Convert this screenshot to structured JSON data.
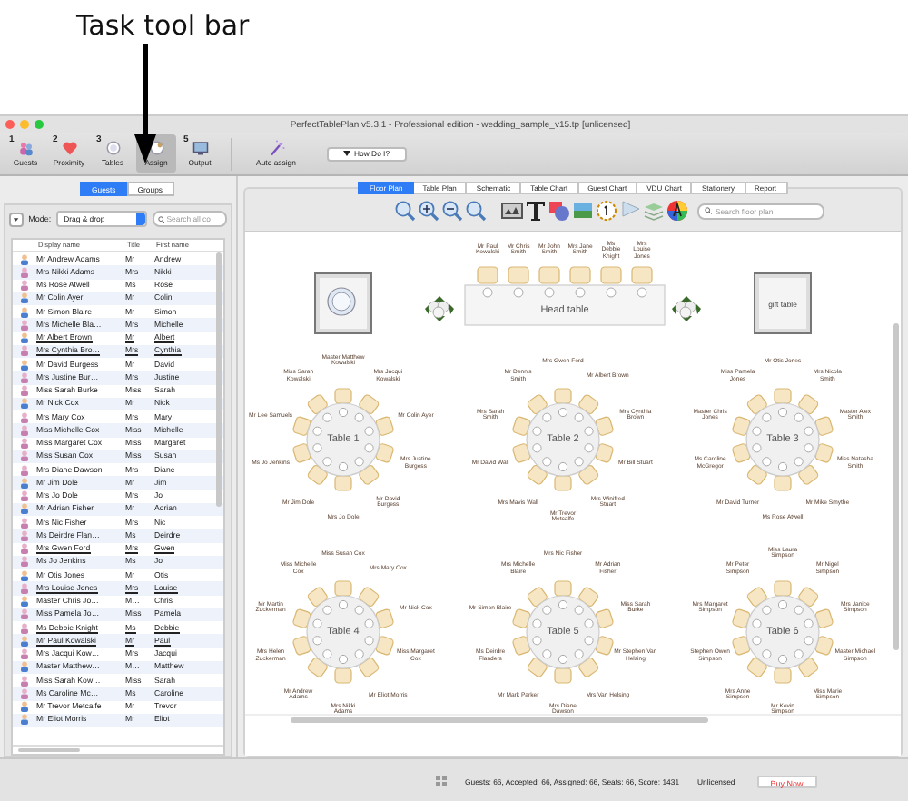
{
  "annotation": {
    "text": "Task tool bar"
  },
  "window": {
    "title": "PerfectTablePlan v5.3.1 - Professional edition - wedding_sample_v15.tp [unlicensed]"
  },
  "toolbar": {
    "tasks": [
      {
        "number": "1",
        "label": "Guests",
        "selected": false
      },
      {
        "number": "2",
        "label": "Proximity",
        "selected": false
      },
      {
        "number": "3",
        "label": "Tables",
        "selected": false
      },
      {
        "label": "Assign",
        "selected": true
      },
      {
        "number": "5",
        "label": "Output",
        "selected": false
      }
    ],
    "auto_assign": "Auto assign",
    "help_button": "How Do I?"
  },
  "left_panel": {
    "tabs": [
      {
        "label": "Guests",
        "selected": true
      },
      {
        "label": "Groups",
        "selected": false
      }
    ],
    "mode_label": "Mode:",
    "mode_value": "Drag & drop",
    "search_placeholder": "Search all co",
    "columns": [
      "Display name",
      "Title",
      "First name"
    ],
    "rows": [
      {
        "kind": "male",
        "name": "Mr Andrew Adams",
        "title": "Mr",
        "first": "Andrew",
        "underlined": false
      },
      {
        "kind": "female",
        "name": "Mrs Nikki Adams",
        "title": "Mrs",
        "first": "Nikki",
        "underlined": false
      },
      {
        "kind": "female",
        "name": "Ms Rose Atwell",
        "title": "Ms",
        "first": "Rose",
        "underlined": false
      },
      {
        "kind": "male",
        "name": "Mr Colin Ayer",
        "title": "Mr",
        "first": "Colin",
        "underlined": false
      },
      {
        "kind": "male",
        "name": "Mr Simon Blaire",
        "title": "Mr",
        "first": "Simon",
        "underlined": false
      },
      {
        "kind": "female",
        "name": "Mrs Michelle Bla…",
        "title": "Mrs",
        "first": "Michelle",
        "underlined": false
      },
      {
        "kind": "male",
        "name": "Mr Albert Brown",
        "title": "Mr",
        "first": "Albert",
        "underlined": true
      },
      {
        "kind": "female",
        "name": "Mrs Cynthia Bro…",
        "title": "Mrs",
        "first": "Cynthia",
        "underlined": true
      },
      {
        "kind": "male",
        "name": "Mr David Burgess",
        "title": "Mr",
        "first": "David",
        "underlined": false
      },
      {
        "kind": "female",
        "name": "Mrs Justine Bur…",
        "title": "Mrs",
        "first": "Justine",
        "underlined": false
      },
      {
        "kind": "female",
        "name": "Miss Sarah Burke",
        "title": "Miss",
        "first": "Sarah",
        "underlined": false
      },
      {
        "kind": "male",
        "name": "Mr Nick Cox",
        "title": "Mr",
        "first": "Nick",
        "underlined": false
      },
      {
        "kind": "female",
        "name": "Mrs Mary Cox",
        "title": "Mrs",
        "first": "Mary",
        "underlined": false
      },
      {
        "kind": "female",
        "name": "Miss Michelle Cox",
        "title": "Miss",
        "first": "Michelle",
        "underlined": false
      },
      {
        "kind": "female",
        "name": "Miss Margaret Cox",
        "title": "Miss",
        "first": "Margaret",
        "underlined": false
      },
      {
        "kind": "female",
        "name": "Miss Susan Cox",
        "title": "Miss",
        "first": "Susan",
        "underlined": false
      },
      {
        "kind": "female",
        "name": "Mrs Diane Dawson",
        "title": "Mrs",
        "first": "Diane",
        "underlined": false
      },
      {
        "kind": "male",
        "name": "Mr Jim Dole",
        "title": "Mr",
        "first": "Jim",
        "underlined": false
      },
      {
        "kind": "female",
        "name": "Mrs Jo Dole",
        "title": "Mrs",
        "first": "Jo",
        "underlined": false
      },
      {
        "kind": "male",
        "name": "Mr Adrian Fisher",
        "title": "Mr",
        "first": "Adrian",
        "underlined": false
      },
      {
        "kind": "female",
        "name": "Mrs Nic Fisher",
        "title": "Mrs",
        "first": "Nic",
        "underlined": false
      },
      {
        "kind": "female",
        "name": "Ms Deirdre Flan…",
        "title": "Ms",
        "first": "Deirdre",
        "underlined": false
      },
      {
        "kind": "female",
        "name": "Mrs Gwen Ford",
        "title": "Mrs",
        "first": "Gwen",
        "underlined": true
      },
      {
        "kind": "female",
        "name": "Ms Jo Jenkins",
        "title": "Ms",
        "first": "Jo",
        "underlined": false
      },
      {
        "kind": "male",
        "name": "Mr Otis Jones",
        "title": "Mr",
        "first": "Otis",
        "underlined": false
      },
      {
        "kind": "female",
        "name": "Mrs Louise Jones",
        "title": "Mrs",
        "first": "Louise",
        "underlined": true
      },
      {
        "kind": "male",
        "name": "Master Chris Jo…",
        "title": "M…",
        "first": "Chris",
        "underlined": false
      },
      {
        "kind": "female",
        "name": "Miss Pamela Jo…",
        "title": "Miss",
        "first": "Pamela",
        "underlined": false
      },
      {
        "kind": "female",
        "name": "Ms Debbie Knight",
        "title": "Ms",
        "first": "Debbie",
        "underlined": true
      },
      {
        "kind": "male",
        "name": "Mr Paul Kowalski",
        "title": "Mr",
        "first": "Paul",
        "underlined": true
      },
      {
        "kind": "female",
        "name": "Mrs Jacqui Kow…",
        "title": "Mrs",
        "first": "Jacqui",
        "underlined": false
      },
      {
        "kind": "male",
        "name": "Master Matthew…",
        "title": "M…",
        "first": "Matthew",
        "underlined": false
      },
      {
        "kind": "female",
        "name": "Miss Sarah Kow…",
        "title": "Miss",
        "first": "Sarah",
        "underlined": false
      },
      {
        "kind": "female",
        "name": "Ms Caroline Mc…",
        "title": "Ms",
        "first": "Caroline",
        "underlined": false
      },
      {
        "kind": "male",
        "name": "Mr Trevor Metcalfe",
        "title": "Mr",
        "first": "Trevor",
        "underlined": false
      },
      {
        "kind": "male",
        "name": "Mr Eliot Morris",
        "title": "Mr",
        "first": "Eliot",
        "underlined": false
      }
    ]
  },
  "right_panel": {
    "tabs": [
      {
        "label": "Floor Plan",
        "selected": true
      },
      {
        "label": "Table Plan",
        "selected": false
      },
      {
        "label": "Schematic",
        "selected": false
      },
      {
        "label": "Table Chart",
        "selected": false
      },
      {
        "label": "Guest Chart",
        "selected": false
      },
      {
        "label": "VDU Chart",
        "selected": false
      },
      {
        "label": "Stationery",
        "selected": false
      },
      {
        "label": "Report",
        "selected": false
      }
    ],
    "search_placeholder": "Search floor plan",
    "floor_plan": {
      "head_table": {
        "label": "Head table",
        "seats": [
          "Mr Paul Kowalski",
          "Mr Chris Smith",
          "Mr John Smith",
          "Mrs Jane Smith",
          "Ms Debbie Knight",
          "Mrs Louise Jones"
        ]
      },
      "gift_table": {
        "label": "gift table"
      },
      "tables": [
        {
          "label": "Table 1",
          "seats": [
            "Master Matthew Kowalski",
            "Miss Sarah Kowalski",
            "Mrs Jacqui Kowalski",
            "Mr Lee Samuels",
            "Mr Colin Ayer",
            "Ms Jo Jenkins",
            "Mrs Justine Burgess",
            "Mr Jim Dole",
            "Mr David Burgess",
            "Mrs Jo Dole"
          ]
        },
        {
          "label": "Table 2",
          "seats": [
            "Mrs Gwen Ford",
            "Mr Dennis Smith",
            "Mr Albert Brown",
            "Mrs Sarah Smith",
            "Mrs Cynthia Brown",
            "Mr David Wall",
            "Mr Bill Stuart",
            "Mrs Mavis Wall",
            "Mrs Winifred Stuart",
            "Mr Trevor Metcalfe"
          ]
        },
        {
          "label": "Table 3",
          "seats": [
            "Mr Otis Jones",
            "Miss Pamela Jones",
            "Mrs Nicola Smith",
            "Master Chris Jones",
            "Master Alex Smith",
            "Ms Caroline McGregor",
            "Miss Natasha Smith",
            "Mr David Turner",
            "Mr Mike Smythe",
            "Ms Rose Atwell"
          ]
        },
        {
          "label": "Table 4",
          "seats": [
            "Miss Susan Cox",
            "Miss Michelle Cox",
            "Mrs Mary Cox",
            "Mr Martin Zuckerman",
            "Mr Nick Cox",
            "Mrs Helen Zuckerman",
            "Miss Margaret Cox",
            "Mr Andrew Adams",
            "Mr Eliot Morris",
            "Mrs Nikki Adams"
          ]
        },
        {
          "label": "Table 5",
          "seats": [
            "Mrs Nic Fisher",
            "Mrs Michelle Blaire",
            "Mr Adrian Fisher",
            "Mr Simon Blaire",
            "Miss Sarah Burke",
            "Ms Deirdre Flanders",
            "Mr Stephen Van Helsing",
            "Mr Mark Parker",
            "Mrs Van Helsing",
            "Mrs Diane Dawson"
          ]
        },
        {
          "label": "Table 6",
          "seats": [
            "Miss Laura Simpson",
            "Mr Peter Simpson",
            "Mr Nigel Simpson",
            "Mrs Margaret Simpson",
            "Mrs Janice Simpson",
            "Stephen Owen Simpson",
            "Master Michael Simpson",
            "Mrs Anne Simpson",
            "Miss Marie Simpson",
            "Mr Kevin Simpson"
          ]
        }
      ]
    }
  },
  "status_bar": {
    "summary": "Guests: 66, Accepted: 66, Assigned: 66, Seats: 66, Score: 1431",
    "license": "Unlicensed",
    "buy_button": "Buy Now"
  }
}
